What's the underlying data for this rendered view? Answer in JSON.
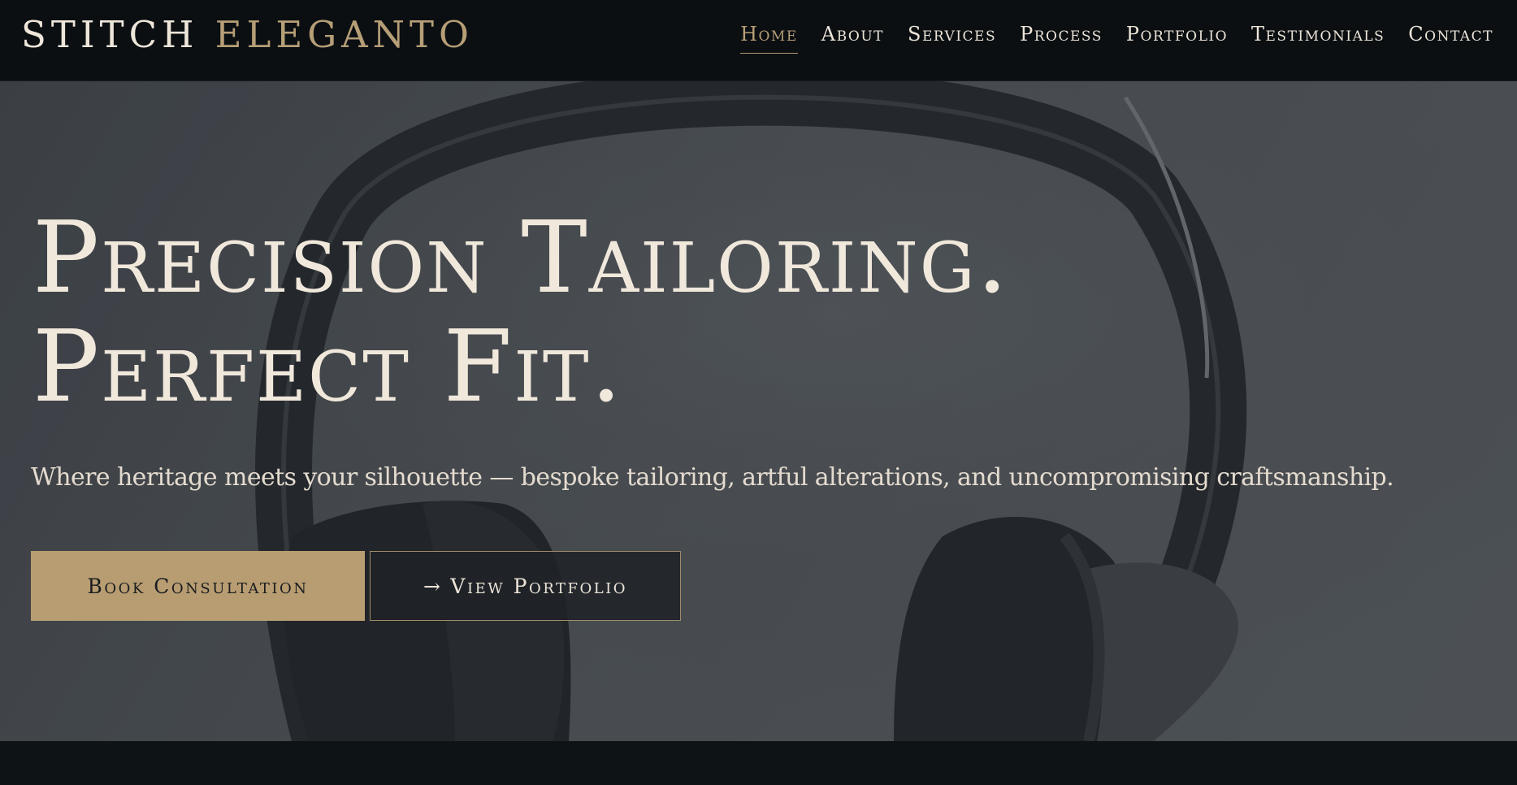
{
  "brand": {
    "name_part1": "STITCH",
    "name_part2": "ELEGANTO",
    "accent_color": "#b69e76"
  },
  "nav": {
    "items": [
      {
        "label": "Home",
        "active": true
      },
      {
        "label": "About",
        "active": false
      },
      {
        "label": "Services",
        "active": false
      },
      {
        "label": "Process",
        "active": false
      },
      {
        "label": "Portfolio",
        "active": false
      },
      {
        "label": "Testimonials",
        "active": false
      },
      {
        "label": "Contact",
        "active": false
      }
    ]
  },
  "hero": {
    "headline_line1": "Precision Tailoring.",
    "headline_line2": "Perfect Fit.",
    "tagline": "Where heritage meets your silhouette — bespoke tailoring, artful alterations, and uncompromising craftsmanship.",
    "primary_cta": "Book Consultation",
    "secondary_cta_icon": "→",
    "secondary_cta": "View Portfolio",
    "background_image": "headphones-photo"
  },
  "colors": {
    "header_bg": "#0b0f12",
    "text_light": "#f1e8dc",
    "gold": "#b89d72"
  }
}
